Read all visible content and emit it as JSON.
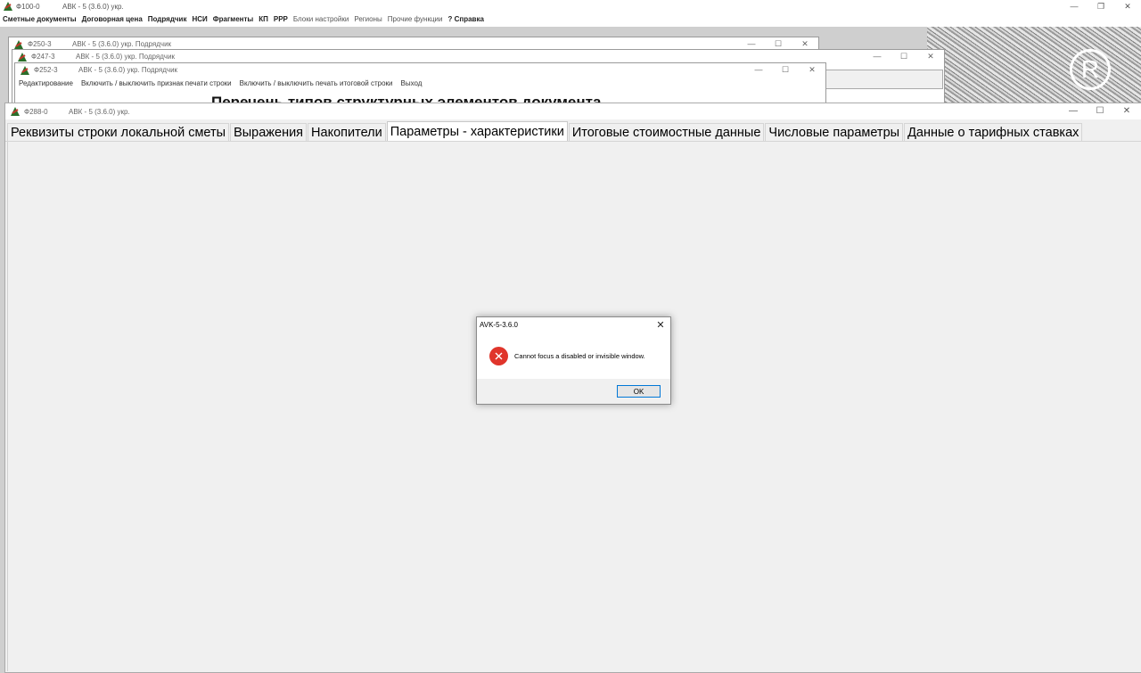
{
  "main_window": {
    "code": "Ф100-0",
    "app": "АВК - 5 (3.6.0) укр.",
    "menu": [
      {
        "label": "Сметные документы",
        "style": "bold"
      },
      {
        "label": "Договорная цена",
        "style": "bold"
      },
      {
        "label": "Подрядчик",
        "style": "bold"
      },
      {
        "label": "НСИ",
        "style": "bold"
      },
      {
        "label": "Фрагменты",
        "style": "bold"
      },
      {
        "label": "КП",
        "style": "bold"
      },
      {
        "label": "РРР",
        "style": "bold"
      },
      {
        "label": "Блоки настройки",
        "style": "gray"
      },
      {
        "label": "Регионы",
        "style": "gray"
      },
      {
        "label": "Прочие функции",
        "style": "gray"
      },
      {
        "label": "? Справка",
        "style": "bold"
      }
    ]
  },
  "windows": {
    "w250": {
      "code": "Ф250-3",
      "app": "АВК - 5 (3.6.0) укр. Подрядчик"
    },
    "w247": {
      "code": "Ф247-3",
      "app": "АВК - 5 (3.6.0) укр. Подрядчик"
    },
    "w252": {
      "code": "Ф252-3",
      "app": "АВК - 5 (3.6.0) укр. Подрядчик",
      "menu": [
        "Редактирование",
        "Включить / выключить признак печати строки",
        "Включить / выключить печать итоговой строки",
        "Выход"
      ],
      "doc_title": "Перечень типов структурных элементов документа"
    },
    "w288": {
      "code": "Ф288-0",
      "app": "АВК - 5 (3.6.0) укр.",
      "tabs": [
        "Реквизиты строки локальной сметы",
        "Выражения",
        "Накопители",
        "Параметры - характеристики",
        "Итоговые стоимостные данные",
        "Числовые параметры",
        "Данные о тарифных ставках"
      ],
      "active_tab": 3
    }
  },
  "dialog": {
    "title": "AVK-5-3.6.0",
    "message": "Cannot focus a disabled or invisible window.",
    "ok_label": "OK",
    "icon": "error-icon",
    "icon_color": "#e0352b"
  },
  "colors": {
    "accent": "#0078d7",
    "error": "#e0352b"
  }
}
